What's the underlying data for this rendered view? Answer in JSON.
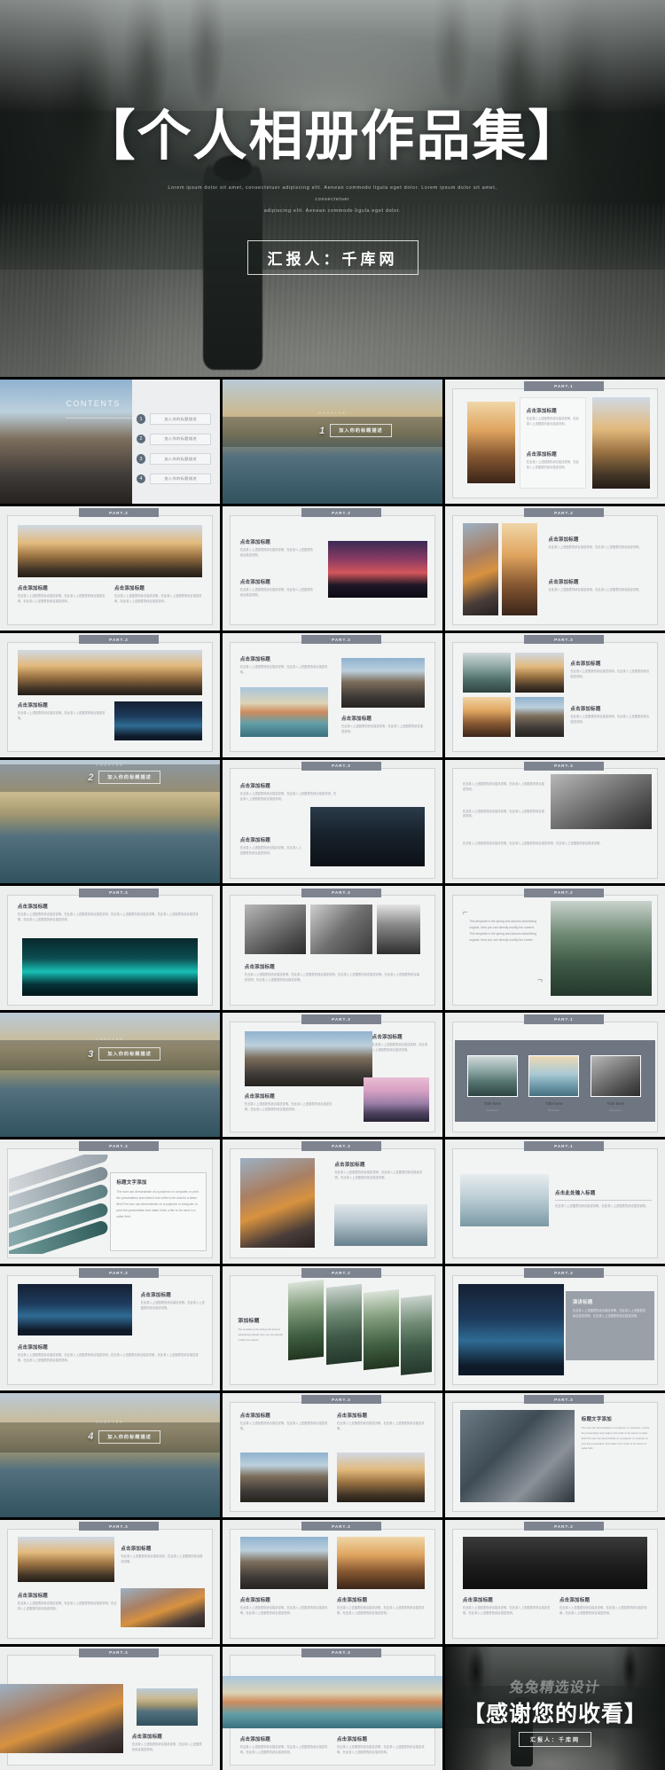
{
  "cover": {
    "title": "【个人相册作品集】",
    "subtitle_line1": "Lorem ipsum dolor sit amet, consectetuer adipiscing elit. Aenean commodo ligula eget dolor. Lorem ipsum dolor sit amet, consectetuer",
    "subtitle_line2": "adipiscing elit. Aenean commodo ligula eget dolor.",
    "author": "汇报人：千库网"
  },
  "labels": {
    "part": "PART.1",
    "part2": "PART.2",
    "part3": "PART.3",
    "contents_heading": "CONTENTS",
    "chapter_word": "CHAPTER",
    "add_title": "点击添加标题",
    "add_title_alt": "点击添加标题",
    "title_text_add": "标题文字添加",
    "add_title_cn": "添加标题",
    "speech_title": "演讲标题",
    "click_add_title_here": "点击此处输入标题",
    "section_label": "加入你的标题描述",
    "body_cn_short": "在此录入上述图表的综合描述说明，在此录入上述图表的综合描述说明。",
    "body_cn_med": "在此录入上述图表的综合描述说明，在此录入上述图表的综合描述说明，在此录入上述图表的综合描述说明。",
    "body_cn_long": "在此录入上述图表的综合描述说明，在此录入上述图表的综合描述说明，在此录入上述图表的综合描述说明，在此录入上述图表的综合描述说明，在此录入上述图表的综合描述说明。",
    "body_en": "The user can demonstrate on a projector or computer, or print the presentation and make it into a film to be used in a wider field.The user can demonstrate on a projector or computer or print the presentation and make it into a film to be used in a wider field.",
    "body_en_2": "This template is the spring and autumn advertising original, here you can directly modify the content. This template is the spring and autumn advertising original, here you can directly modify the conten",
    "body_en_3": "The template is the spring and autumn advertising original, here you can directly modify the content.",
    "tile_title": "Title here",
    "tile_sub": "Illustration"
  },
  "contents": {
    "heading": "CONTENTS",
    "items": [
      {
        "num": "1",
        "label": "加入你的标题描述"
      },
      {
        "num": "2",
        "label": "加入你的标题描述"
      },
      {
        "num": "3",
        "label": "加入你的标题描述"
      },
      {
        "num": "4",
        "label": "加入你的标题描述"
      }
    ]
  },
  "sections": [
    {
      "num": "1",
      "label": "加入你的标题描述",
      "word": "CHAPTER"
    },
    {
      "num": "2",
      "label": "加入你的标题描述",
      "word": "CHAPTER"
    },
    {
      "num": "3",
      "label": "加入你的标题描述",
      "word": "CHAPTER"
    },
    {
      "num": "4",
      "label": "加入你的标题描述",
      "word": "CHAPTER"
    }
  ],
  "thankyou": {
    "watermark": "兔兔精选设计",
    "title": "【感谢您的收看】",
    "author": "汇报人：千库网"
  },
  "colors": {
    "part_tag_bg": "#7d8490",
    "slide_bg": "#eceded",
    "frame_bg": "#f2f3f3",
    "border": "#cfd2d4",
    "title_text": "#3a3f46",
    "body_text": "#9aa0a6",
    "accent_circle": "#5c6a7a",
    "page_bg": "#000000"
  }
}
